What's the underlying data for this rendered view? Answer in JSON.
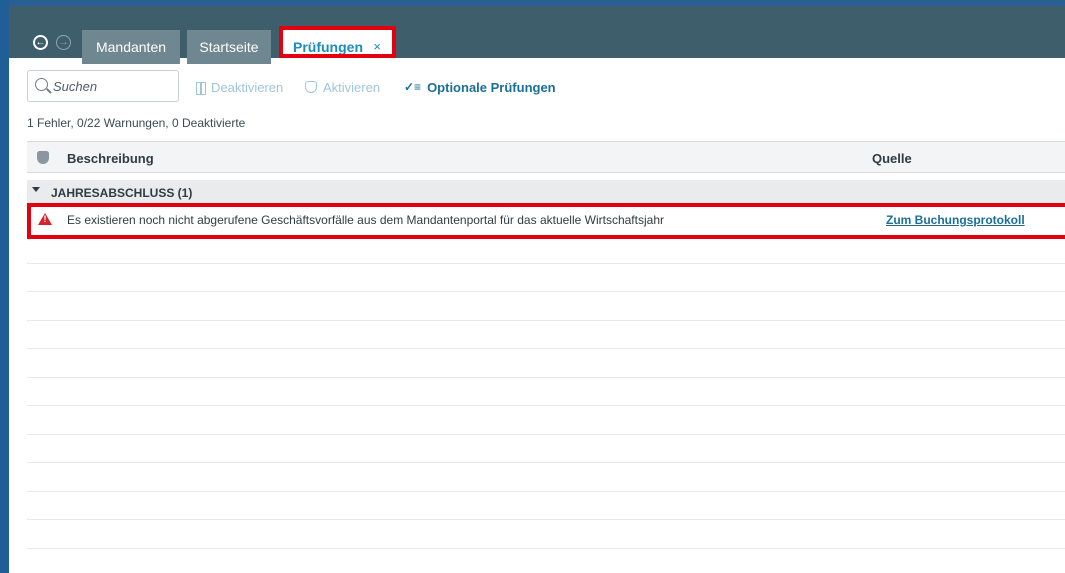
{
  "window": {
    "accent_color": "#1f5e96",
    "tabbar_color": "#3f5e6c"
  },
  "nav": {
    "back_icon": "arrow-left-circle",
    "forward_icon": "arrow-right-circle"
  },
  "tabs": [
    {
      "label": "Mandanten",
      "active": false
    },
    {
      "label": "Startseite",
      "active": false
    },
    {
      "label": "Prüfungen",
      "active": true,
      "close_symbol": "×"
    }
  ],
  "toolbar": {
    "search_placeholder": "Suchen",
    "deactivate_label": "Deaktivieren",
    "activate_label": "Aktivieren",
    "optional_label": "Optionale Prüfungen"
  },
  "summary": "1 Fehler, 0/22 Warnungen, 0 Deaktivierte",
  "table": {
    "columns": {
      "description": "Beschreibung",
      "source": "Quelle"
    },
    "group": {
      "label": "JAHRESABSCHLUSS (1)",
      "expanded": true
    },
    "rows": [
      {
        "severity": "error",
        "description": "Es existieren noch nicht abgerufene Geschäftsvorfälle aus dem Mandantenportal für das aktuelle Wirtschaftsjahr",
        "source_link": "Zum Buchungsprotokoll"
      }
    ]
  },
  "highlight_color": "#e3000f"
}
